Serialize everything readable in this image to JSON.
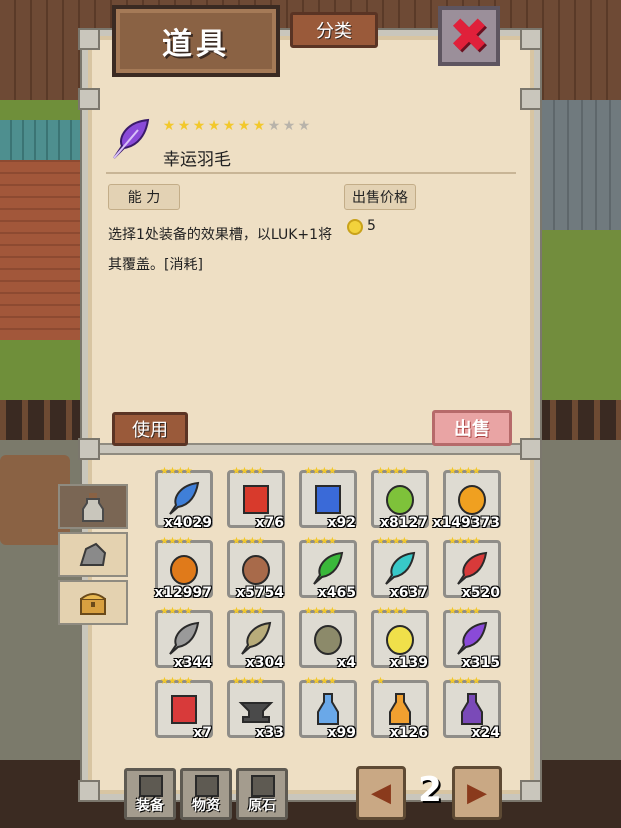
{
  "header": {
    "title": "道具",
    "sort_label": "分类",
    "close_glyph": "✖"
  },
  "item": {
    "name": "幸运羽毛",
    "stars_filled": 7,
    "stars_total": 10,
    "icon": "purple-feather-icon",
    "ability_label": "能 力",
    "description": "选择1处装备的效果槽，以LUK+1将其覆盖。[消耗]",
    "price_label": "出售价格",
    "price": "5",
    "use_label": "使用",
    "sell_label": "出售"
  },
  "side_tabs": [
    {
      "icon": "potion-bottle-icon",
      "active": true
    },
    {
      "icon": "ore-rock-icon",
      "active": false
    },
    {
      "icon": "treasure-chest-icon",
      "active": false
    }
  ],
  "items": [
    {
      "icon": "blue-feather-icon",
      "color": "#3f7fd8",
      "stars": 4,
      "count": "x4029"
    },
    {
      "icon": "red-book-icon",
      "color": "#d83a2c",
      "stars": 4,
      "count": "x76"
    },
    {
      "icon": "blue-book-icon",
      "color": "#3a6ad8",
      "stars": 4,
      "count": "x92"
    },
    {
      "icon": "green-grapes-icon",
      "color": "#7ec23a",
      "stars": 4,
      "count": "x8127"
    },
    {
      "icon": "pineapple-icon",
      "color": "#f0a020",
      "stars": 4,
      "count": "x149373"
    },
    {
      "icon": "orange-pouch-icon",
      "color": "#e07a1a",
      "stars": 4,
      "count": "x12997"
    },
    {
      "icon": "shop-stall-icon",
      "color": "#a86a4a",
      "stars": 4,
      "count": "x5754"
    },
    {
      "icon": "green-feather-icon",
      "color": "#3ab83a",
      "stars": 4,
      "count": "x465"
    },
    {
      "icon": "cyan-feather-icon",
      "color": "#38c8c8",
      "stars": 4,
      "count": "x637"
    },
    {
      "icon": "red-feather-icon",
      "color": "#d83a3a",
      "stars": 4,
      "count": "x520"
    },
    {
      "icon": "gray-feather-icon",
      "color": "#9a9a9a",
      "stars": 4,
      "count": "x344"
    },
    {
      "icon": "tan-feather-icon",
      "color": "#b8ac7a",
      "stars": 4,
      "count": "x304"
    },
    {
      "icon": "scroll-tablet-icon",
      "color": "#8c8a6a",
      "stars": 4,
      "count": "x4"
    },
    {
      "icon": "yellow-crystal-icon",
      "color": "#f0e04a",
      "stars": 4,
      "count": "x139"
    },
    {
      "icon": "purple-feather-icon",
      "color": "#8a4ad8",
      "stars": 4,
      "count": "x315"
    },
    {
      "icon": "red-tome-icon",
      "color": "#d83a3a",
      "stars": 4,
      "count": "x7"
    },
    {
      "icon": "anvil-icon",
      "color": "#4a4a4a",
      "stars": 4,
      "count": "x33"
    },
    {
      "icon": "blue-potion-icon",
      "color": "#6aa8e8",
      "stars": 4,
      "count": "x99"
    },
    {
      "icon": "orange-potion-icon",
      "color": "#f0a030",
      "stars": 1,
      "count": "x126"
    },
    {
      "icon": "purple-flask-icon",
      "color": "#7a4ab8",
      "stars": 4,
      "count": "x24"
    }
  ],
  "bottom_nav": [
    {
      "icon": "crossed-swords-icon",
      "label": "装备"
    },
    {
      "icon": "crate-icon",
      "label": "物资"
    },
    {
      "icon": "ore-icon",
      "label": "原石"
    }
  ],
  "pagination": {
    "page": "2",
    "prev_glyph": "◀",
    "next_glyph": "▶"
  }
}
